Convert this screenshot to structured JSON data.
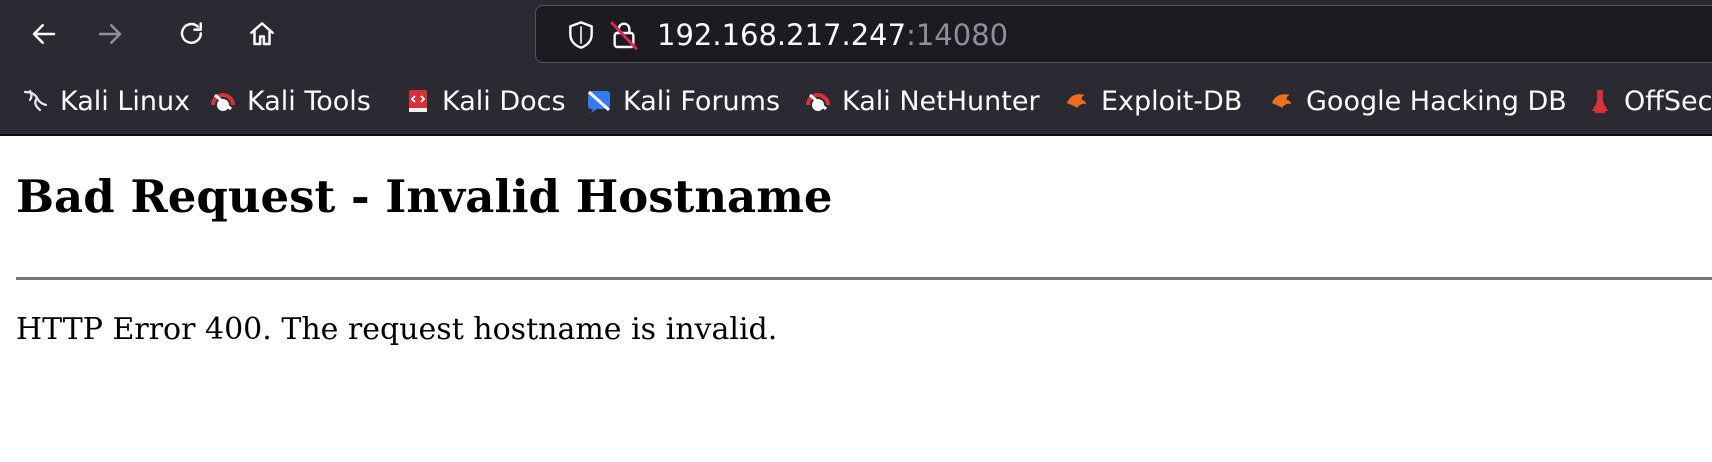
{
  "toolbar": {
    "back_icon": "arrow-left-icon",
    "forward_icon": "arrow-right-icon",
    "reload_icon": "reload-icon",
    "home_icon": "home-icon",
    "url": {
      "host": "192.168.217.247",
      "port": ":14080",
      "shield_icon": "shield-icon",
      "security_icon": "insecure-lock-icon"
    }
  },
  "bookmarks": [
    {
      "label": "Kali Linux",
      "icon": "kali-dragon-icon"
    },
    {
      "label": "Kali Tools",
      "icon": "kali-tools-icon"
    },
    {
      "label": "Kali Docs",
      "icon": "kali-docs-icon"
    },
    {
      "label": "Kali Forums",
      "icon": "kali-forums-icon"
    },
    {
      "label": "Kali NetHunter",
      "icon": "kali-nethunter-icon"
    },
    {
      "label": "Exploit-DB",
      "icon": "exploit-db-icon"
    },
    {
      "label": "Google Hacking DB",
      "icon": "ghdb-icon"
    },
    {
      "label": "OffSec",
      "icon": "offsec-icon"
    }
  ],
  "page": {
    "title": "Bad Request - Invalid Hostname",
    "message": "HTTP Error 400. The request hostname is invalid."
  },
  "colors": {
    "toolbar_bg": "#2b2a33",
    "urlbar_bg": "#1c1b22",
    "text_light": "#fbfbfe",
    "port_gray": "#8f8f9d",
    "exploitdb_orange": "#ec6e20",
    "kali_red": "#d6323a",
    "kali_blue": "#367bf0"
  }
}
